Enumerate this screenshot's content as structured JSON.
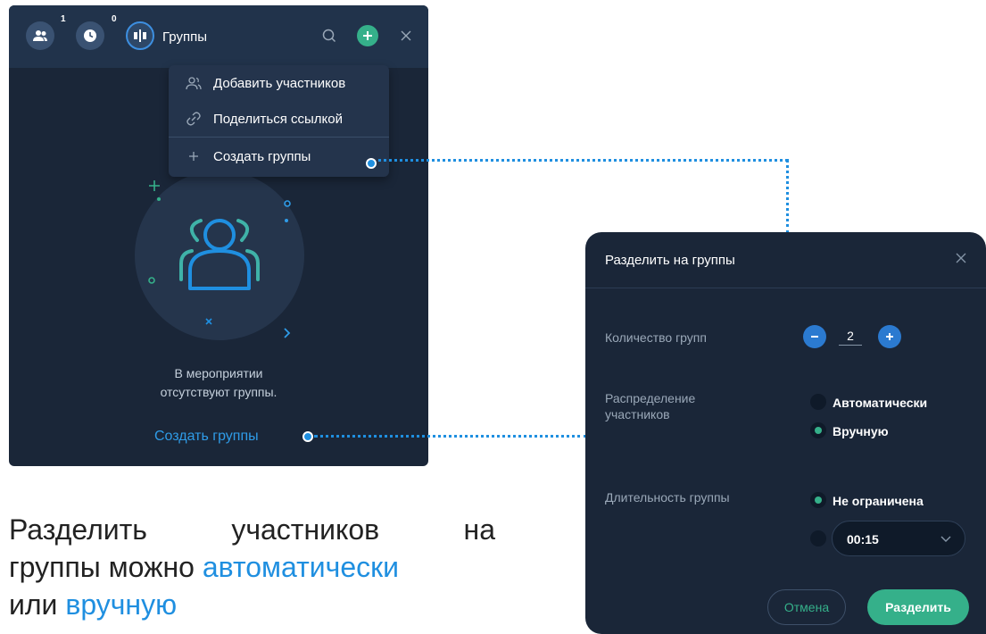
{
  "panel": {
    "participants_badge": "1",
    "clock_badge": "0",
    "tab_title": "Группы",
    "menu": {
      "items": [
        {
          "label": "Добавить участников",
          "icon": "add-participants-icon"
        },
        {
          "label": "Поделиться ссылкой",
          "icon": "link-icon"
        },
        {
          "label": "Создать группы",
          "icon": "plus-icon"
        }
      ]
    },
    "empty_text_line1": "В мероприятии",
    "empty_text_line2": "отсутствуют группы.",
    "create_link": "Создать группы"
  },
  "caption": {
    "line1_words": [
      "Разделить",
      "участников",
      "на"
    ],
    "line2_prefix": "группы можно ",
    "line2_accent": "автоматически",
    "line3_prefix": "или ",
    "line3_accent": "вручную"
  },
  "dialog": {
    "title": "Разделить на группы",
    "count_label": "Количество групп",
    "count_value": "2",
    "distribution_label": "Распределение участников",
    "option_auto": "Автоматически",
    "option_manual": "Вручную",
    "selected_distribution": "Вручную",
    "duration_label": "Длительность группы",
    "option_unlimited": "Не ограничена",
    "selected_duration": "Не ограничена",
    "time_value": "00:15",
    "cancel": "Отмена",
    "split": "Разделить"
  },
  "colors": {
    "accent": "#1f8fe0",
    "green": "#35b08a",
    "panel_bg": "#1a2638"
  }
}
